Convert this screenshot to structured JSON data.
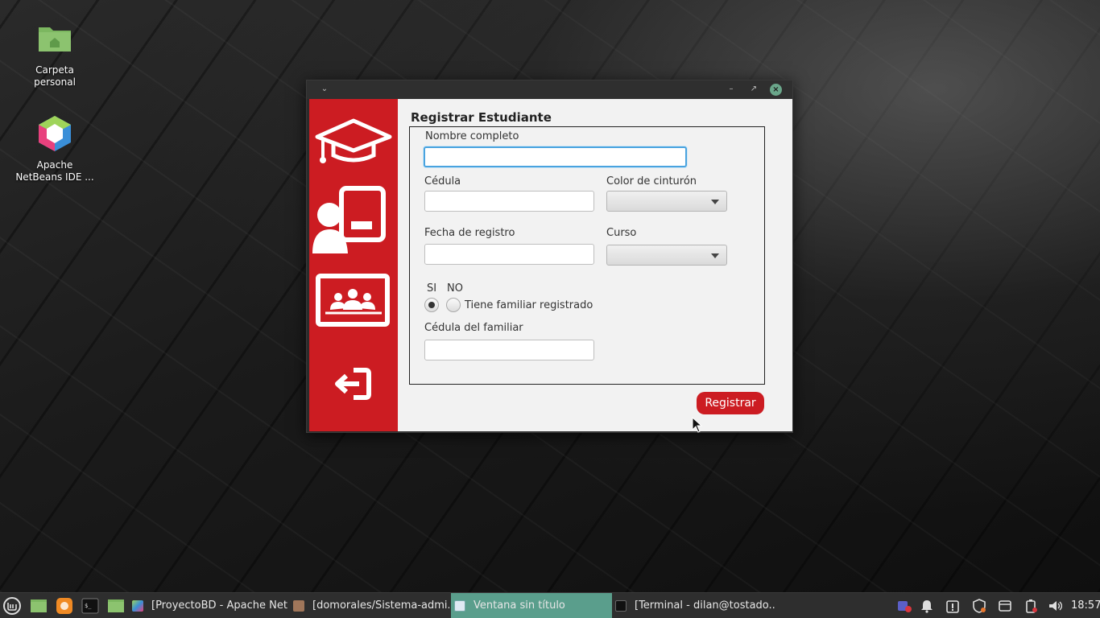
{
  "desktop": {
    "icons": [
      {
        "label": "Carpeta personal",
        "icon": "folder-home-icon"
      },
      {
        "label": "Apache NetBeans IDE ...",
        "icon": "netbeans-icon"
      }
    ]
  },
  "window": {
    "sidebar": {
      "items": [
        {
          "icon": "graduation-cap-icon"
        },
        {
          "icon": "teacher-board-icon"
        },
        {
          "icon": "classroom-icon"
        },
        {
          "icon": "logout-icon"
        }
      ],
      "accent": "#cc1c22"
    },
    "form": {
      "title": "Registrar Estudiante",
      "nombre_label": "Nombre completo",
      "nombre_value": "",
      "cedula_label": "Cédula",
      "cedula_value": "",
      "cinturon_label": "Color de cinturón",
      "cinturon_value": "",
      "fecha_label": "Fecha de registro",
      "fecha_value": "",
      "curso_label": "Curso",
      "curso_value": "",
      "si_label": "SI",
      "no_label": "NO",
      "familiar_label": "Tiene familiar registrado",
      "familiar_selected": "SI",
      "cedula_familiar_label": "Cédula del familiar",
      "cedula_familiar_value": "",
      "submit_label": "Registrar"
    }
  },
  "taskbar": {
    "windows": [
      {
        "label": "[ProyectoBD - Apache Net...",
        "icon": "netbeans-icon"
      },
      {
        "label": "[domorales/Sistema-admi...",
        "icon": "browser-icon"
      },
      {
        "label": "Ventana sin título",
        "icon": "window-icon",
        "active": true
      },
      {
        "label": "[Terminal - dilan@tostado...",
        "icon": "terminal-icon"
      }
    ],
    "clock": "18:57",
    "active_color": "#5a9e8c"
  }
}
